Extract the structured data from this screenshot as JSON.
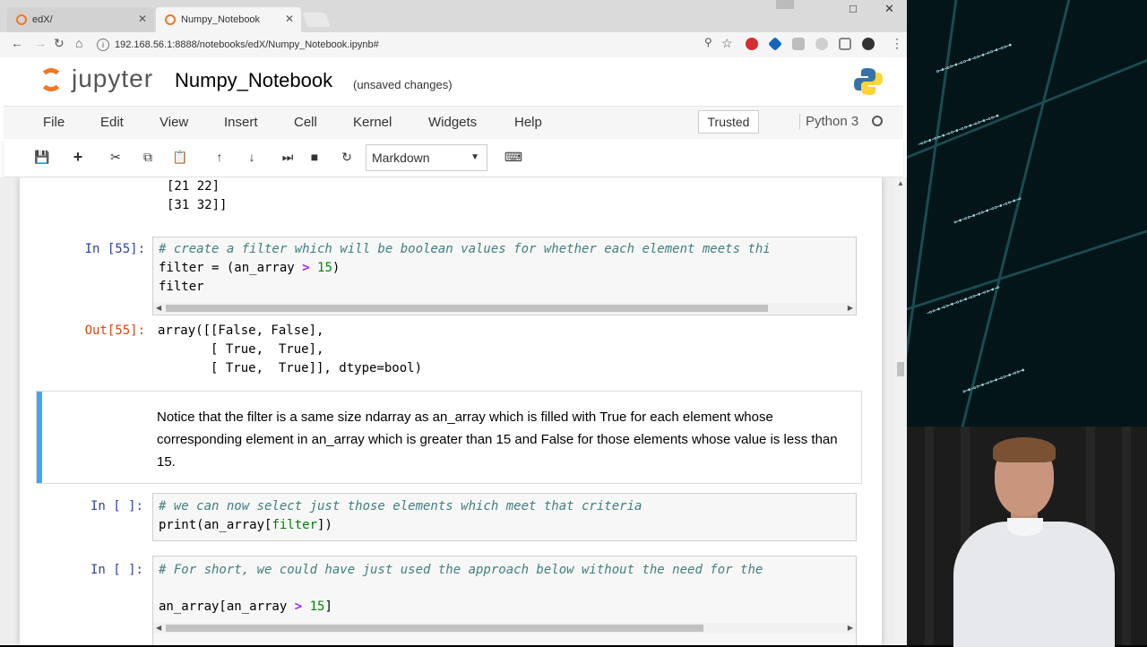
{
  "browser": {
    "tabs": [
      {
        "title": "edX/"
      },
      {
        "title": "Numpy_Notebook"
      }
    ],
    "url": "192.168.56.1:8888/notebooks/edX/Numpy_Notebook.ipynb#"
  },
  "jupyter": {
    "logo_text": "jupyter",
    "notebook_title": "Numpy_Notebook",
    "save_status": "(unsaved changes)",
    "menu": [
      "File",
      "Edit",
      "View",
      "Insert",
      "Cell",
      "Kernel",
      "Widgets",
      "Help"
    ],
    "trusted": "Trusted",
    "kernel": "Python 3",
    "cell_type": "Markdown"
  },
  "cells": {
    "prev_output": [
      "[21 22]",
      "[31 32]]"
    ],
    "c55": {
      "prompt": "In [55]:",
      "comment": "# create a filter which will be boolean values for whether each element meets thi",
      "line2_a": "filter = (an_array ",
      "line2_op": ">",
      "line2_sp": " ",
      "line2_num": "15",
      "line2_b": ")",
      "line3": "filter"
    },
    "o55": {
      "prompt": "Out[55]:",
      "lines": [
        "array([[False, False],",
        "       [ True,  True],",
        "       [ True,  True]], dtype=bool)"
      ]
    },
    "markdown": "Notice that the filter is a same size ndarray as an_array which is filled with True for each element whose corresponding element in an_array which is greater than 15 and False for those elements whose value is less than 15.",
    "c_select": {
      "prompt": "In [ ]:",
      "comment": "# we can now select just those elements which meet that criteria",
      "line2_a": "print(an_array[",
      "line2_kw": "filter",
      "line2_b": "])"
    },
    "c_short": {
      "prompt": "In [ ]:",
      "comment": "# For short, we could have just used the approach below without the need for the",
      "line3_a": "an_array[an_array ",
      "line3_op": ">",
      "line3_sp": " ",
      "line3_num": "15",
      "line3_b": "]"
    }
  }
}
